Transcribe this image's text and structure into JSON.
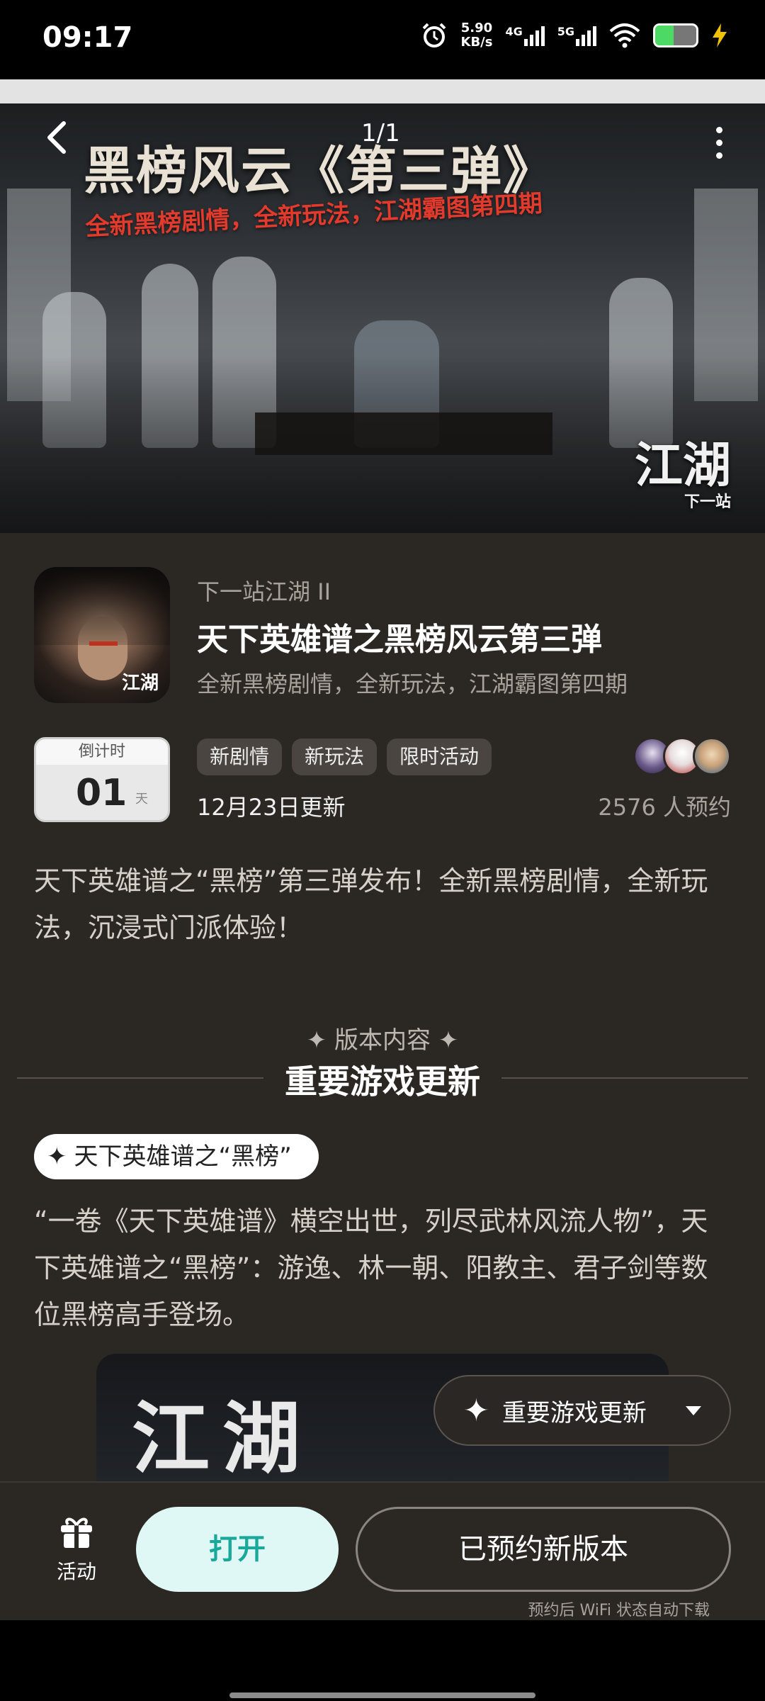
{
  "status_bar": {
    "time": "09:17",
    "speed_value": "5.90",
    "speed_unit": "KB/s",
    "net1": "4G",
    "net2": "5G",
    "battery_level": 0.45,
    "icons": [
      "alarm-icon",
      "signal-icon",
      "wifi-icon",
      "battery-icon",
      "charging-icon"
    ]
  },
  "banner": {
    "counter": "1/1",
    "title": "黑榜风云《第三弹》",
    "subtitle": "全新黑榜剧情，全新玩法，江湖霸图第四期",
    "logo_text": "江湖",
    "logo_sub": "下一站"
  },
  "app": {
    "icon_text": "江湖",
    "developer": "下一站江湖 II",
    "title": "天下英雄谱之黑榜风云第三弹",
    "description": "全新黑榜剧情，全新玩法，江湖霸图第四期"
  },
  "countdown": {
    "label": "倒计时",
    "value": "01",
    "unit": "天"
  },
  "tags": [
    "新剧情",
    "新玩法",
    "限时活动"
  ],
  "update_date": "12月23日更新",
  "reserve_count": "2576 人预约",
  "intro": "天下英雄谱之“黑榜”第三弹发布！全新黑榜剧情，全新玩法，沉浸式门派体验！",
  "section": {
    "subtitle": "✦ 版本内容 ✦",
    "title": "重要游戏更新"
  },
  "subsection": {
    "label": "天下英雄谱之“黑榜”"
  },
  "body_text": "“一卷《天下英雄谱》横空出世，列尽武林风流人物”，天下英雄谱之“黑榜”：游逸、林一朝、阳教主、君子剑等数位黑榜高手登场。",
  "embed": {
    "logo_text": "江湖"
  },
  "float_button": {
    "label": "重要游戏更新"
  },
  "bottom": {
    "activity_label": "活动",
    "open_label": "打开",
    "reserved_label": "已预约新版本",
    "wifi_note": "预约后 WiFi 状态自动下载"
  },
  "colors": {
    "background": "#2b2723",
    "open_button_bg": "#dff8f5",
    "open_button_text": "#1aa89b",
    "banner_subtitle": "#e23a2c"
  }
}
